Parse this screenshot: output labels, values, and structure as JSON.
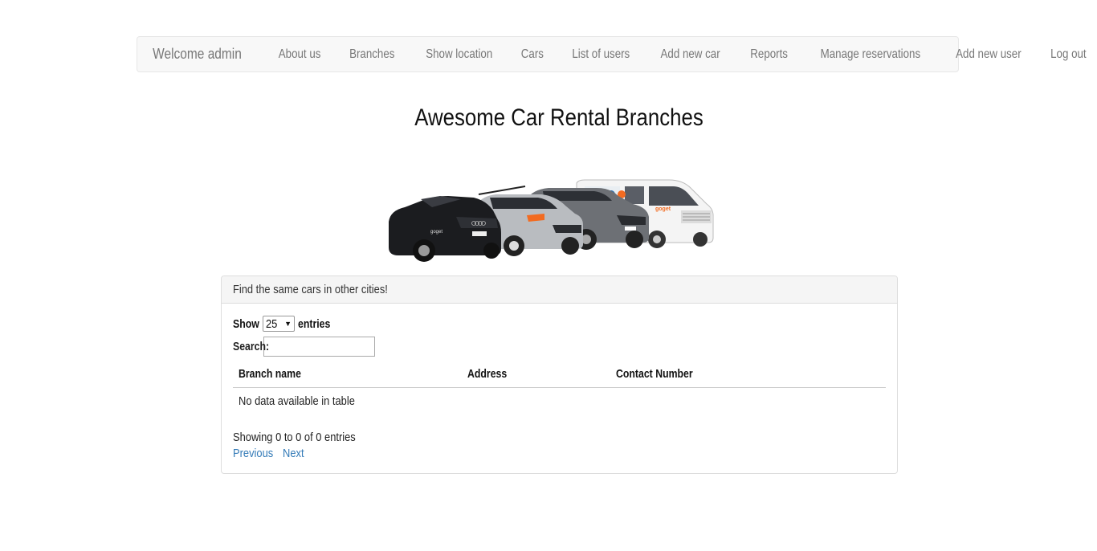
{
  "navbar": {
    "brand_label": "Welcome admin",
    "brand_icon": "car-icon",
    "items": [
      {
        "label": "About us"
      },
      {
        "label": "Branches"
      },
      {
        "label": "Show location"
      },
      {
        "label": "Cars"
      },
      {
        "label": "List of users"
      },
      {
        "label": "Add new car"
      },
      {
        "label": "Reports"
      },
      {
        "label": "Manage reservations"
      },
      {
        "label": "Add new user"
      },
      {
        "label": "Log out"
      }
    ]
  },
  "page": {
    "title": "Awesome Car Rental Branches"
  },
  "panel": {
    "heading": "Find the same cars in other cities!",
    "show_label": "Show",
    "entries_value": "25",
    "entries_label": "entries",
    "search_label": "Search:",
    "search_value": "",
    "columns": [
      "Branch name",
      "Address",
      "Contact Number"
    ],
    "empty_message": "No data available in table",
    "info": "Showing 0 to 0 of 0 entries",
    "prev_label": "Previous",
    "next_label": "Next"
  },
  "colors": {
    "link": "#337ab7",
    "nav_text": "#777777",
    "navbar_bg": "#f8f8f8",
    "brand_orange": "#f26b21"
  }
}
